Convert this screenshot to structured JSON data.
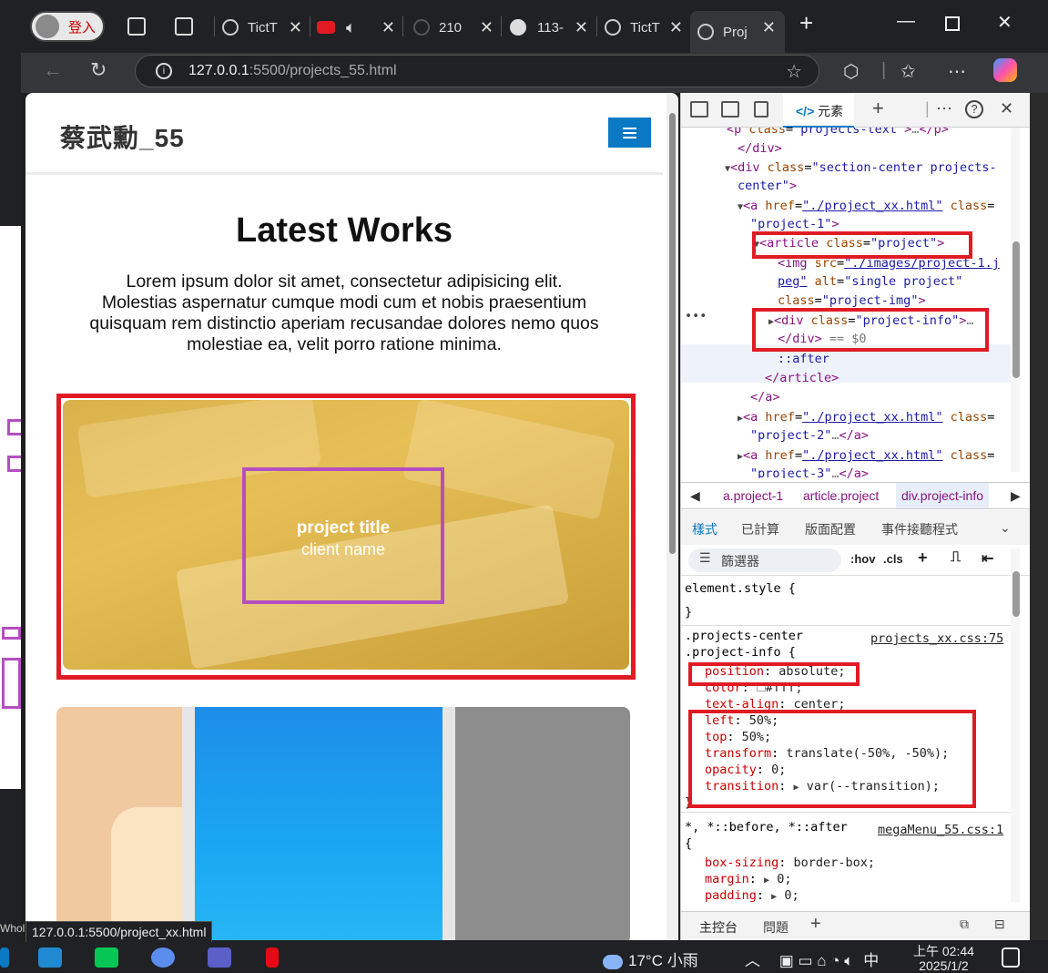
{
  "browser": {
    "profile_label": "登入",
    "tabs": [
      {
        "label": "TictT",
        "active": false
      },
      {
        "label": "",
        "active": false
      },
      {
        "label": "210",
        "active": false
      },
      {
        "label": "113-",
        "active": false
      },
      {
        "label": "TictT",
        "active": false
      },
      {
        "label": "Proj",
        "active": true
      }
    ],
    "url_host": "127.0.0.1",
    "url_rest": ":5500/projects_55.html",
    "status_url": "127.0.0.1:5500/project_xx.html",
    "left_label": "Whol"
  },
  "page": {
    "brand": "蔡武勳_55",
    "section_title": "Latest Works",
    "section_text": "Lorem ipsum dolor sit amet, consectetur adipisicing elit. Molestias aspernatur cumque modi cum et nobis praesentium quisquam rem distinctio aperiam recusandae dolores nemo quos molestiae ea, velit porro ratione minima.",
    "project1": {
      "title": "project title",
      "client": "client name"
    }
  },
  "devtools": {
    "active_tab": "元素",
    "dom_lines": [
      {
        "text": "<p class=\"projects-text\">…</p>"
      },
      {
        "text": "</div>"
      },
      {
        "text": "<div class=\"section-center projects-center\">"
      },
      {
        "text": "<a href=\"./project_xx.html\" class=\"project-1\">"
      },
      {
        "text": "<article class=\"project\">"
      },
      {
        "text": "<img src=\"./images/project-1.jpeg\" alt=\"single project\" class=\"project-img\">"
      },
      {
        "text": "<div class=\"project-info\">…</div> == $0"
      },
      {
        "text": "::after"
      },
      {
        "text": "</article>"
      },
      {
        "text": "</a>"
      },
      {
        "text": "<a href=\"./project_xx.html\" class=\"project-2\">…</a>"
      },
      {
        "text": "<a href=\"./project_xx.html\" class=\"project-3\">…</a>"
      }
    ],
    "breadcrumbs": [
      "a.project-1",
      "article.project",
      "div.project-info"
    ],
    "style_tabs": [
      "樣式",
      "已計算",
      "版面配置",
      "事件接聽程式"
    ],
    "filter_placeholder": "篩選器",
    "filter_tools": [
      ":hov",
      ".cls"
    ],
    "rule1": {
      "selector_line1": ".projects-center",
      "selector_line2": ".project-info {",
      "source": "projects_xx.css:75",
      "decls": [
        {
          "prop": "position",
          "val": "absolute;"
        },
        {
          "prop": "color",
          "val": "#fff;"
        },
        {
          "prop": "text-align",
          "val": "center;"
        },
        {
          "prop": "left",
          "val": "50%;"
        },
        {
          "prop": "top",
          "val": "50%;"
        },
        {
          "prop": "transform",
          "val": "translate(-50%, -50%);"
        },
        {
          "prop": "opacity",
          "val": "0;"
        },
        {
          "prop": "transition",
          "val": "var(--transition);"
        }
      ]
    },
    "element_style": "element.style {",
    "rule2": {
      "selector": "*, *::before, *::after",
      "source": "megaMenu_55.css:1",
      "decls": [
        {
          "prop": "box-sizing",
          "val": "border-box;"
        },
        {
          "prop": "margin",
          "val": "0;"
        },
        {
          "prop": "padding",
          "val": "0;"
        }
      ]
    },
    "console_tabs": [
      "主控台",
      "問題"
    ]
  },
  "taskbar": {
    "weather": "17°C 小雨",
    "ime": "中",
    "time": "上午 02:44",
    "date": "2025/1/2"
  },
  "colors": {
    "accent": "#0a78c2",
    "highlight_red": "#e01b24",
    "highlight_purple": "#b44fc0",
    "project_overlay": "#e0b44c"
  }
}
